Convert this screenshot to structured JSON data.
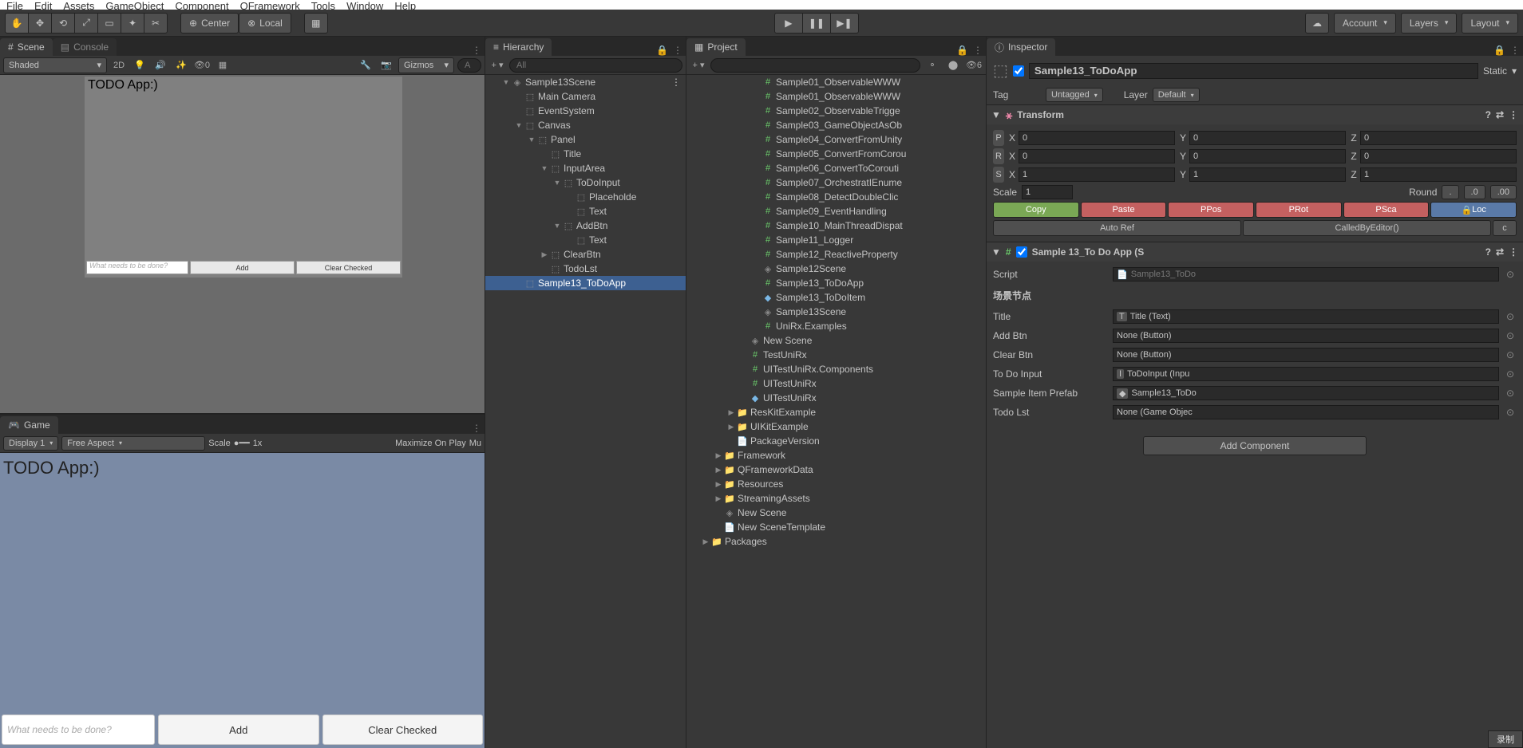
{
  "menubar": [
    "File",
    "Edit",
    "Assets",
    "GameObject",
    "Component",
    "QFramework",
    "Tools",
    "Window",
    "Help"
  ],
  "toolbar": {
    "center": "Center",
    "local": "Local",
    "account": "Account",
    "layers": "Layers",
    "layout": "Layout"
  },
  "scene": {
    "tab_scene": "Scene",
    "tab_console": "Console",
    "shaded": "Shaded",
    "mode2d": "2D",
    "gizmo_count": "0",
    "gizmos": "Gizmos",
    "search_placeholder": "A",
    "title": "TODO App:)",
    "input_placeholder": "What needs to be done?",
    "add_btn": "Add",
    "clear_btn": "Clear Checked"
  },
  "game": {
    "tab": "Game",
    "display": "Display 1",
    "aspect": "Free Aspect",
    "scale_label": "Scale",
    "scale_val": "1x",
    "maximize": "Maximize On Play",
    "mute": "Mu",
    "title": "TODO App:)",
    "input_placeholder": "What needs to be done?",
    "add_btn": "Add",
    "clear_btn": "Clear Checked"
  },
  "hierarchy": {
    "tab": "Hierarchy",
    "search_placeholder": "All",
    "items": [
      {
        "indent": 0,
        "arrow": "▼",
        "icon": "unity",
        "label": "Sample13Scene",
        "menu": true
      },
      {
        "indent": 1,
        "arrow": "",
        "icon": "cube",
        "label": "Main Camera"
      },
      {
        "indent": 1,
        "arrow": "",
        "icon": "cube",
        "label": "EventSystem"
      },
      {
        "indent": 1,
        "arrow": "▼",
        "icon": "cube",
        "label": "Canvas"
      },
      {
        "indent": 2,
        "arrow": "▼",
        "icon": "cube",
        "label": "Panel"
      },
      {
        "indent": 3,
        "arrow": "",
        "icon": "cube",
        "label": "Title"
      },
      {
        "indent": 3,
        "arrow": "▼",
        "icon": "cube",
        "label": "InputArea"
      },
      {
        "indent": 4,
        "arrow": "▼",
        "icon": "cube",
        "label": "ToDoInput"
      },
      {
        "indent": 5,
        "arrow": "",
        "icon": "cube",
        "label": "Placeholde"
      },
      {
        "indent": 5,
        "arrow": "",
        "icon": "cube",
        "label": "Text"
      },
      {
        "indent": 4,
        "arrow": "▼",
        "icon": "cube",
        "label": "AddBtn"
      },
      {
        "indent": 5,
        "arrow": "",
        "icon": "cube",
        "label": "Text"
      },
      {
        "indent": 3,
        "arrow": "▶",
        "icon": "cube",
        "label": "ClearBtn"
      },
      {
        "indent": 3,
        "arrow": "",
        "icon": "cube",
        "label": "TodoLst"
      },
      {
        "indent": 1,
        "arrow": "",
        "icon": "cube",
        "label": "Sample13_ToDoApp",
        "selected": true
      }
    ]
  },
  "project": {
    "tab": "Project",
    "hidden_count": "6",
    "items": [
      {
        "indent": 2,
        "arrow": "",
        "icon": "script",
        "label": "Sample01_ObservableWWW"
      },
      {
        "indent": 2,
        "arrow": "",
        "icon": "script",
        "label": "Sample01_ObservableWWW"
      },
      {
        "indent": 2,
        "arrow": "",
        "icon": "script",
        "label": "Sample02_ObservableTrigge"
      },
      {
        "indent": 2,
        "arrow": "",
        "icon": "script",
        "label": "Sample03_GameObjectAsOb"
      },
      {
        "indent": 2,
        "arrow": "",
        "icon": "script",
        "label": "Sample04_ConvertFromUnity"
      },
      {
        "indent": 2,
        "arrow": "",
        "icon": "script",
        "label": "Sample05_ConvertFromCorou"
      },
      {
        "indent": 2,
        "arrow": "",
        "icon": "script",
        "label": "Sample06_ConvertToCorouti"
      },
      {
        "indent": 2,
        "arrow": "",
        "icon": "script",
        "label": "Sample07_OrchestratIEnume"
      },
      {
        "indent": 2,
        "arrow": "",
        "icon": "script",
        "label": "Sample08_DetectDoubleClic"
      },
      {
        "indent": 2,
        "arrow": "",
        "icon": "script",
        "label": "Sample09_EventHandling"
      },
      {
        "indent": 2,
        "arrow": "",
        "icon": "script",
        "label": "Sample10_MainThreadDispat"
      },
      {
        "indent": 2,
        "arrow": "",
        "icon": "script",
        "label": "Sample11_Logger"
      },
      {
        "indent": 2,
        "arrow": "",
        "icon": "script",
        "label": "Sample12_ReactiveProperty"
      },
      {
        "indent": 2,
        "arrow": "",
        "icon": "unity",
        "label": "Sample12Scene"
      },
      {
        "indent": 2,
        "arrow": "",
        "icon": "script",
        "label": "Sample13_ToDoApp"
      },
      {
        "indent": 2,
        "arrow": "",
        "icon": "prefab",
        "label": "Sample13_ToDoItem"
      },
      {
        "indent": 2,
        "arrow": "",
        "icon": "unity",
        "label": "Sample13Scene"
      },
      {
        "indent": 2,
        "arrow": "",
        "icon": "script",
        "label": "UniRx.Examples"
      },
      {
        "indent": 1,
        "arrow": "",
        "icon": "unity",
        "label": "New Scene"
      },
      {
        "indent": 1,
        "arrow": "",
        "icon": "script",
        "label": "TestUniRx"
      },
      {
        "indent": 1,
        "arrow": "",
        "icon": "script",
        "label": "UITestUniRx.Components"
      },
      {
        "indent": 1,
        "arrow": "",
        "icon": "script",
        "label": "UITestUniRx"
      },
      {
        "indent": 1,
        "arrow": "",
        "icon": "prefab",
        "label": "UITestUniRx"
      },
      {
        "indent": 0,
        "arrow": "▶",
        "icon": "folder",
        "label": "ResKitExample"
      },
      {
        "indent": 0,
        "arrow": "▶",
        "icon": "folder",
        "label": "UIKitExample"
      },
      {
        "indent": 0,
        "arrow": "",
        "icon": "file",
        "label": "PackageVersion"
      },
      {
        "indent": -1,
        "arrow": "▶",
        "icon": "folder",
        "label": "Framework"
      },
      {
        "indent": -1,
        "arrow": "▶",
        "icon": "folder",
        "label": "QFrameworkData"
      },
      {
        "indent": -1,
        "arrow": "▶",
        "icon": "folder",
        "label": "Resources"
      },
      {
        "indent": -1,
        "arrow": "▶",
        "icon": "folder",
        "label": "StreamingAssets"
      },
      {
        "indent": -1,
        "arrow": "",
        "icon": "unity",
        "label": "New Scene"
      },
      {
        "indent": -1,
        "arrow": "",
        "icon": "file",
        "label": "New SceneTemplate"
      },
      {
        "indent": -2,
        "arrow": "▶",
        "icon": "folder",
        "label": "Packages"
      }
    ]
  },
  "inspector": {
    "tab": "Inspector",
    "name": "Sample13_ToDoApp",
    "static": "Static",
    "tag_label": "Tag",
    "tag_value": "Untagged",
    "layer_label": "Layer",
    "layer_value": "Default",
    "transform": {
      "title": "Transform",
      "p": {
        "x": "0",
        "y": "0",
        "z": "0"
      },
      "r": {
        "x": "0",
        "y": "0",
        "z": "0"
      },
      "s": {
        "x": "1",
        "y": "1",
        "z": "1"
      },
      "scale_label": "Scale",
      "scale_val": "1",
      "round": "Round",
      "dot": ".",
      "d0": ".0",
      "d00": ".00",
      "copy": "Copy",
      "paste": "Paste",
      "ppos": "PPos",
      "prot": "PRot",
      "psca": "PSca",
      "loc": "Loc",
      "autoref": "Auto Ref",
      "called": "CalledByEditor()",
      "c": "c"
    },
    "script_comp": {
      "title": "Sample 13_To Do App (S",
      "script_label": "Script",
      "script_val": "Sample13_ToDo",
      "section": "场景节点",
      "props": [
        {
          "label": "Title",
          "val": "Title (Text)",
          "icon": "T"
        },
        {
          "label": "Add Btn",
          "val": "None (Button)",
          "icon": ""
        },
        {
          "label": "Clear Btn",
          "val": "None (Button)",
          "icon": ""
        },
        {
          "label": "To Do Input",
          "val": "ToDoInput (Inpu",
          "icon": "I"
        },
        {
          "label": "Sample Item Prefab",
          "val": "Sample13_ToDo",
          "icon": "◆"
        },
        {
          "label": "Todo Lst",
          "val": "None (Game Objec",
          "icon": ""
        }
      ]
    },
    "add_component": "Add Component"
  },
  "bottom": {
    "record": "录制"
  }
}
